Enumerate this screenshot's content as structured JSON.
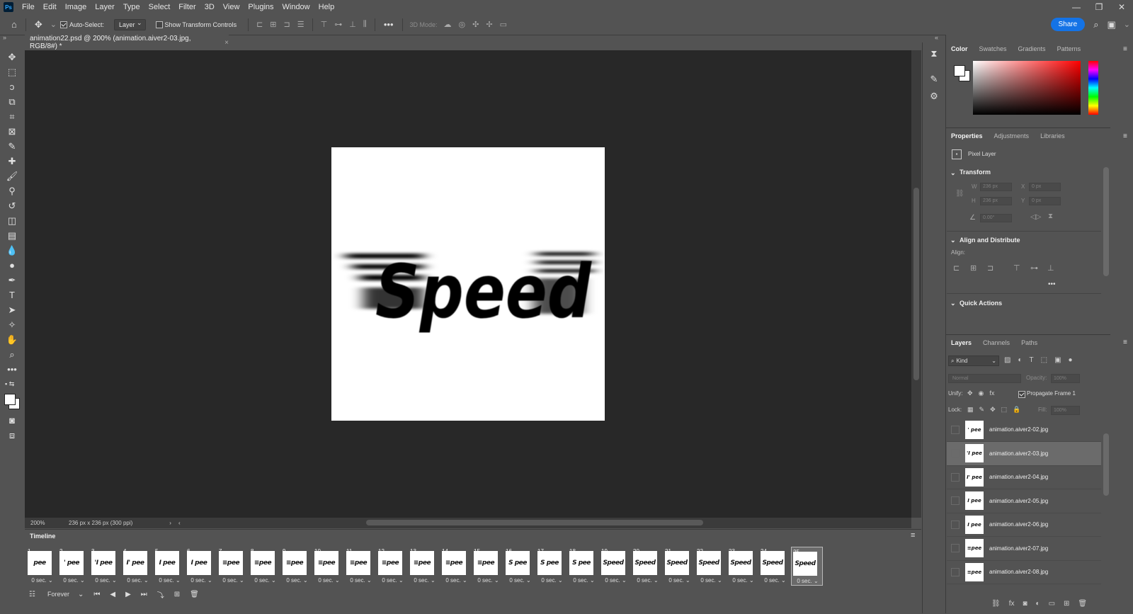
{
  "menu": {
    "logo": "Ps",
    "items": [
      "File",
      "Edit",
      "Image",
      "Layer",
      "Type",
      "Select",
      "Filter",
      "3D",
      "View",
      "Plugins",
      "Window",
      "Help"
    ]
  },
  "window_controls": [
    "—",
    "❐",
    "✕"
  ],
  "options": {
    "auto_select_label": "Auto-Select:",
    "auto_select_value": "Layer",
    "show_transform_label": "Show Transform Controls",
    "mode_3d_label": "3D Mode:",
    "share_label": "Share"
  },
  "document": {
    "tab_title": "animation22.psd @ 200% (animation.aiver2-03.jpg, RGB/8#) *",
    "artwork_text": "Speed",
    "zoom": "200%",
    "doc_info": "236 px x 236 px (300 ppi)"
  },
  "timeline": {
    "title": "Timeline",
    "loop_value": "Forever",
    "selected_frame": 25,
    "frames": [
      {
        "num": "1",
        "thumb": "pee",
        "delay": "0 sec."
      },
      {
        "num": "2",
        "thumb": "' pee",
        "delay": "0 sec."
      },
      {
        "num": "3",
        "thumb": "'I pee",
        "delay": "0 sec."
      },
      {
        "num": "4",
        "thumb": "I' pee",
        "delay": "0 sec."
      },
      {
        "num": "5",
        "thumb": "I pee",
        "delay": "0 sec."
      },
      {
        "num": "6",
        "thumb": "I pee",
        "delay": "0 sec."
      },
      {
        "num": "7",
        "thumb": "≡pee",
        "delay": "0 sec."
      },
      {
        "num": "8",
        "thumb": "≡pee",
        "delay": "0 sec."
      },
      {
        "num": "9",
        "thumb": "≡pee",
        "delay": "0 sec."
      },
      {
        "num": "10",
        "thumb": "≡pee",
        "delay": "0 sec."
      },
      {
        "num": "11",
        "thumb": "≡pee",
        "delay": "0 sec."
      },
      {
        "num": "12",
        "thumb": "≡pee",
        "delay": "0 sec."
      },
      {
        "num": "13",
        "thumb": "≡pee",
        "delay": "0 sec."
      },
      {
        "num": "14",
        "thumb": "≡pee",
        "delay": "0 sec."
      },
      {
        "num": "15",
        "thumb": "≡pee",
        "delay": "0 sec."
      },
      {
        "num": "16",
        "thumb": "S pee",
        "delay": "0 sec."
      },
      {
        "num": "17",
        "thumb": "S pee",
        "delay": "0 sec."
      },
      {
        "num": "18",
        "thumb": "S pee",
        "delay": "0 sec."
      },
      {
        "num": "19",
        "thumb": "Speed",
        "delay": "0 sec."
      },
      {
        "num": "20",
        "thumb": "Speed",
        "delay": "0 sec."
      },
      {
        "num": "21",
        "thumb": "Speed",
        "delay": "0 sec."
      },
      {
        "num": "22",
        "thumb": "Speed",
        "delay": "0 sec."
      },
      {
        "num": "23",
        "thumb": "Speed",
        "delay": "0 sec."
      },
      {
        "num": "24",
        "thumb": "Speed",
        "delay": "0 sec."
      },
      {
        "num": "25",
        "thumb": "Speed",
        "delay": "0 sec."
      }
    ]
  },
  "color_panel": {
    "tabs": [
      "Color",
      "Swatches",
      "Gradients",
      "Patterns"
    ],
    "foreground": "#ffffff",
    "background": "#ffffff",
    "hue": "#ff0000"
  },
  "properties": {
    "tabs": [
      "Properties",
      "Adjustments",
      "Libraries"
    ],
    "layer_type": "Pixel Layer",
    "transform_head": "Transform",
    "w_label": "W",
    "w_value": "236 px",
    "h_label": "H",
    "h_value": "236 px",
    "x_label": "X",
    "x_value": "0 px",
    "y_label": "Y",
    "y_value": "0 px",
    "angle_value": "0.00°",
    "align_head": "Align and Distribute",
    "align_label": "Align:",
    "quick_actions_head": "Quick Actions"
  },
  "layers": {
    "tabs": [
      "Layers",
      "Channels",
      "Paths"
    ],
    "filter_kind": "Kind",
    "blend_mode": "Normal",
    "opacity_label": "Opacity:",
    "opacity_value": "100%",
    "unify_label": "Unify:",
    "propagate_label": "Propagate Frame 1",
    "lock_label": "Lock:",
    "fill_label": "Fill:",
    "fill_value": "100%",
    "selected_index": 1,
    "items": [
      {
        "name": "animation.aiver2-02.jpg",
        "thumb": "' pee"
      },
      {
        "name": "animation.aiver2-03.jpg",
        "thumb": "'I pee"
      },
      {
        "name": "animation.aiver2-04.jpg",
        "thumb": "I' pee"
      },
      {
        "name": "animation.aiver2-05.jpg",
        "thumb": "I pee"
      },
      {
        "name": "animation.aiver2-06.jpg",
        "thumb": "I pee"
      },
      {
        "name": "animation.aiver2-07.jpg",
        "thumb": "≡pee"
      },
      {
        "name": "animation.aiver2-08.jpg",
        "thumb": "≡pee"
      }
    ]
  }
}
